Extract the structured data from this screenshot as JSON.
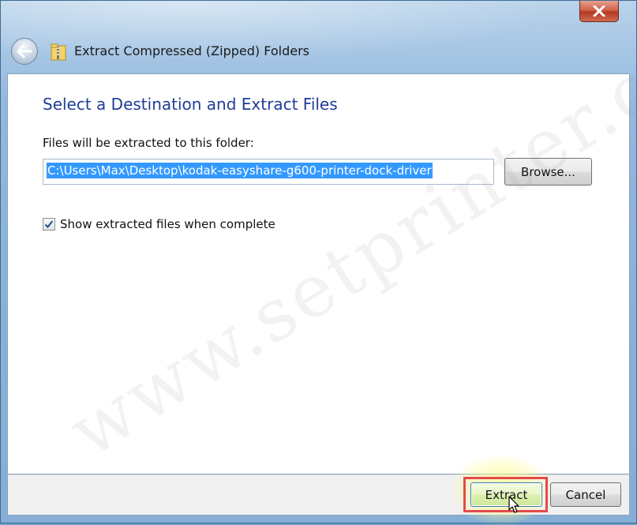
{
  "window": {
    "title": "Extract Compressed (Zipped) Folders"
  },
  "content": {
    "heading": "Select a Destination and Extract Files",
    "folder_label": "Files will be extracted to this folder:",
    "path_value": "C:\\Users\\Max\\Desktop\\kodak-easyshare-g600-printer-dock-driver",
    "browse_label": "Browse...",
    "show_files_label": "Show extracted files when complete",
    "show_files_checked": true
  },
  "footer": {
    "extract_label": "Extract",
    "cancel_label": "Cancel"
  },
  "watermark": "www.setprinter.com",
  "colors": {
    "heading": "#1f3d96",
    "selection": "#3399ff",
    "highlight_box": "#e24b4b",
    "close_button": "#c7503a"
  },
  "icons": {
    "back": "back-arrow-icon",
    "zip_folder": "zip-folder-icon",
    "close": "close-icon",
    "checkmark": "checkmark-icon",
    "cursor": "mouse-pointer-icon"
  }
}
